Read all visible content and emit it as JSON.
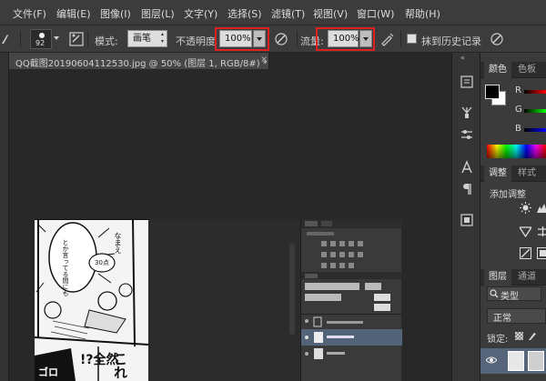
{
  "menu": {
    "items": [
      "文件(F)",
      "编辑(E)",
      "图像(I)",
      "图层(L)",
      "文字(Y)",
      "选择(S)",
      "滤镜(T)",
      "视图(V)",
      "窗口(W)",
      "帮助(H)"
    ]
  },
  "options": {
    "brush_size": "92",
    "mode_label": "模式:",
    "mode_value": "画笔",
    "opacity_label": "不透明度",
    "opacity_value": "100%",
    "flow_label": "流量:",
    "flow_value": "100%",
    "erase_history_label": "抹到历史记录"
  },
  "document": {
    "tab_title": "QQ截图20190604112530.jpg @ 50% (图层 1, RGB/8#) *",
    "close_glyph": "×"
  },
  "panels": {
    "color_tabs": [
      "颜色",
      "色板"
    ],
    "color_channels": [
      "R",
      "G",
      "B"
    ],
    "adjust_tabs": [
      "调整",
      "样式"
    ],
    "adjust_title": "添加调整",
    "layers_tabs": [
      "图层",
      "通道"
    ],
    "layer_kind": "类型",
    "blend_mode": "正常",
    "lock_label": "锁定:"
  },
  "manga": {
    "bubble_1": "とか言ってる間にも",
    "bubble_2": "30点",
    "bubble_3": "なまえ",
    "shout": "!?全然",
    "shout_2": "これ",
    "sfx": "ゴロ"
  },
  "colors": {
    "accent_red": "#e01f1f",
    "foreground": "#000000",
    "background": "#ffffff"
  }
}
